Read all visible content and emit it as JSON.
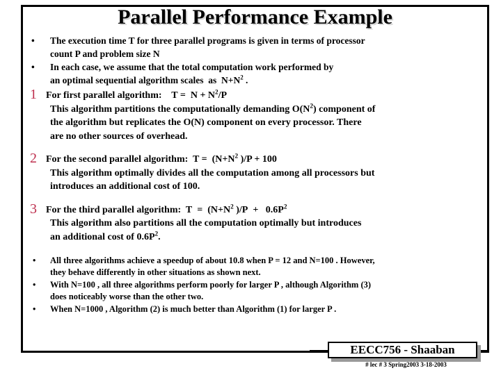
{
  "slide": {
    "title": "Parallel Performance Example",
    "number_marker_color": "#BE2F4E",
    "text_color": "#000000",
    "background_color": "#FFFFFF",
    "border_color": "#000000"
  },
  "bullets_top": [
    {
      "marker": "•",
      "lines": [
        "The execution time T for three parallel programs is given in terms of processor",
        "count  P and problem size  N"
      ]
    },
    {
      "marker": "•",
      "lines": [
        "In each case, we assume that the total computation work performed by",
        "an optimal sequential algorithm scales  as  N+N2 ."
      ]
    }
  ],
  "algorithms": [
    {
      "number": "1",
      "lines": [
        "For first parallel algorithm:    T =  N + N2/P",
        "This algorithm partitions the computationally demanding O(N2) component of",
        "the algorithm but replicates the  O(N) component on every processor.   There",
        "are no other sources of overhead."
      ]
    },
    {
      "number": "2",
      "lines": [
        "For the second parallel algorithm:  T =  (N+N2 )/P + 100",
        "This algorithm optimally divides all the computation among all processors but",
        "introduces an additional cost of 100."
      ]
    },
    {
      "number": "3",
      "lines": [
        "For the third parallel algorithm:  T  =  (N+N2 )/P  +   0.6P2",
        "This algorithm also partitions all the computation optimally but introduces",
        "an additional cost of 0.6P2."
      ]
    }
  ],
  "bullets_bottom": [
    {
      "marker": "•",
      "lines": [
        "All three algorithms achieve a speedup of about 10.8  when  P = 12 and N=100 .  However,",
        "they behave differently in other situations as shown next."
      ]
    },
    {
      "marker": "•",
      "lines": [
        "With N=100 , all three algorithms perform poorly for larger P , although Algorithm (3)",
        "does noticeably worse than the other two."
      ]
    },
    {
      "marker": "•",
      "lines": [
        "When N=1000 , Algorithm (2) is  much better than Algorithm (1) for larger P ."
      ]
    }
  ],
  "footer": {
    "course_label": "EECC756 - Shaaban",
    "meta": "#  lec # 3    Spring2003   3-18-2003"
  }
}
